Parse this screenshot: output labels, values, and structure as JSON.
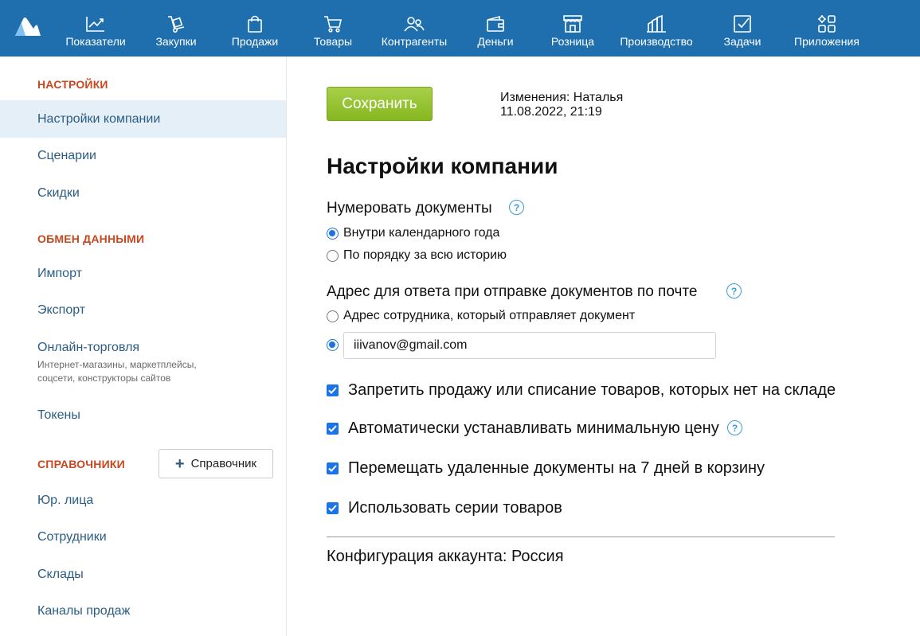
{
  "nav": {
    "items": [
      {
        "label": "Показатели",
        "icon": "chart-line-icon"
      },
      {
        "label": "Закупки",
        "icon": "dolly-cart-icon"
      },
      {
        "label": "Продажи",
        "icon": "shopping-bag-icon"
      },
      {
        "label": "Товары",
        "icon": "cart-icon"
      },
      {
        "label": "Контрагенты",
        "icon": "users-icon"
      },
      {
        "label": "Деньги",
        "icon": "wallet-icon"
      },
      {
        "label": "Розница",
        "icon": "store-icon"
      },
      {
        "label": "Производство",
        "icon": "factory-icon"
      },
      {
        "label": "Задачи",
        "icon": "checkbox-task-icon"
      },
      {
        "label": "Приложения",
        "icon": "apps-grid-icon"
      }
    ]
  },
  "sidebar": {
    "sections": [
      {
        "header": "НАСТРОЙКИ",
        "items": [
          {
            "label": "Настройки компании",
            "active": true
          },
          {
            "label": "Сценарии"
          },
          {
            "label": "Скидки"
          }
        ]
      },
      {
        "header": "ОБМЕН ДАННЫМИ",
        "items": [
          {
            "label": "Импорт"
          },
          {
            "label": "Экспорт"
          },
          {
            "label": "Онлайн-торговля",
            "sub": "Интернет-магазины, маркетплейсы, соцсети, конструкторы сайтов"
          },
          {
            "label": "Токены"
          }
        ]
      },
      {
        "header": "СПРАВОЧНИКИ",
        "button": "Справочник",
        "items": [
          {
            "label": "Юр. лица"
          },
          {
            "label": "Сотрудники"
          },
          {
            "label": "Склады"
          },
          {
            "label": "Каналы продаж"
          }
        ]
      }
    ]
  },
  "main": {
    "save_label": "Сохранить",
    "changes_line1": "Изменения: Наталья",
    "changes_line2": "11.08.2022, 21:19",
    "title": "Настройки компании",
    "numbering": {
      "label": "Нумеровать документы",
      "options": [
        "Внутри календарного года",
        "По порядку за всю историю"
      ],
      "selected": 0
    },
    "reply_address": {
      "label": "Адрес для ответа при отправке документов по почте",
      "option_employee": "Адрес сотрудника, который отправляет документ",
      "email_value": "iiivanov@gmail.com",
      "selected": 1
    },
    "checkboxes": [
      {
        "label": "Запретить продажу или списание товаров, которых нет на складе",
        "checked": true
      },
      {
        "label": "Автоматически устанавливать минимальную цену",
        "checked": true,
        "help": true
      },
      {
        "label": "Перемещать удаленные документы на 7 дней в корзину",
        "checked": true
      },
      {
        "label": "Использовать серии товаров",
        "checked": true
      }
    ],
    "config": "Конфигурация аккаунта: Россия"
  },
  "help_glyph": "?",
  "plus_glyph": "+",
  "colors": {
    "topbar": "#1f6fae",
    "accent_header": "#c8471f",
    "link": "#2b5d84",
    "save": "#8cbf26",
    "checkbox": "#1a73e8"
  }
}
